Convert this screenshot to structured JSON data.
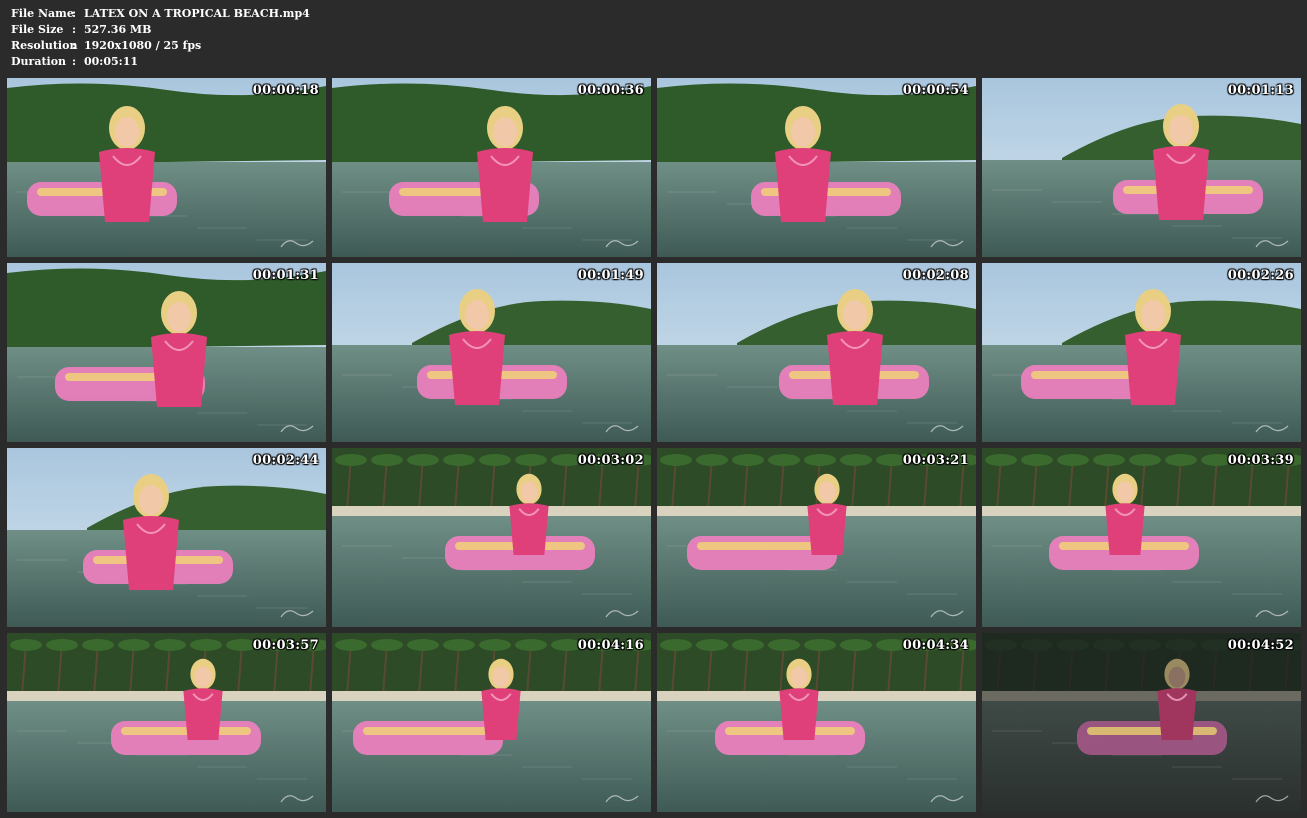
{
  "info": {
    "rows": [
      {
        "key": "File Name",
        "sep": ":",
        "value": "LATEX ON A TROPICAL BEACH.mp4"
      },
      {
        "key": "File Size",
        "sep": ":",
        "value": "527.36 MB"
      },
      {
        "key": "Resolution",
        "sep": ":",
        "value": "1920x1080 / 25 fps"
      },
      {
        "key": "Duration",
        "sep": ":",
        "value": "00:05:11"
      }
    ]
  },
  "thumbnails": [
    {
      "timestamp": "00:00:18",
      "scene": "hills"
    },
    {
      "timestamp": "00:00:36",
      "scene": "hills"
    },
    {
      "timestamp": "00:00:54",
      "scene": "shore"
    },
    {
      "timestamp": "00:01:13",
      "scene": "island"
    },
    {
      "timestamp": "00:01:31",
      "scene": "hills"
    },
    {
      "timestamp": "00:01:49",
      "scene": "island"
    },
    {
      "timestamp": "00:02:08",
      "scene": "island"
    },
    {
      "timestamp": "00:02:26",
      "scene": "island"
    },
    {
      "timestamp": "00:02:44",
      "scene": "island"
    },
    {
      "timestamp": "00:03:02",
      "scene": "palms"
    },
    {
      "timestamp": "00:03:21",
      "scene": "palms"
    },
    {
      "timestamp": "00:03:39",
      "scene": "palms"
    },
    {
      "timestamp": "00:03:57",
      "scene": "palms"
    },
    {
      "timestamp": "00:04:16",
      "scene": "palms"
    },
    {
      "timestamp": "00:04:34",
      "scene": "palms"
    },
    {
      "timestamp": "00:04:52",
      "scene": "dusk"
    }
  ],
  "colors": {
    "background": "#2b2b2b",
    "swimsuit": "#e0407a",
    "float": "#f27fc0",
    "water": "#5f7f72",
    "foliage": "#2f5a2a"
  },
  "icons": {
    "watermark": "watermark-logo"
  }
}
